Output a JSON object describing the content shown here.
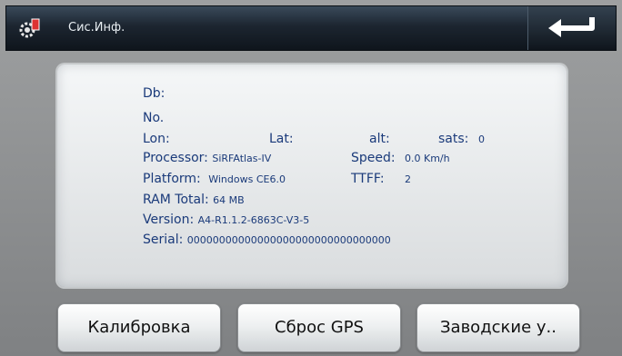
{
  "titlebar": {
    "title": "Сис.Инф.",
    "settings_icon": "settings-gear-icon",
    "back_icon": "return-arrow-icon"
  },
  "info": {
    "db_label": "Db:",
    "no_label": "No.",
    "lon_label": "Lon:",
    "lat_label": "Lat:",
    "alt_label": "alt:",
    "sats_label": "sats:",
    "sats_value": "0",
    "processor_label": "Processor:",
    "processor_value": "SiRFAtlas-IV",
    "speed_label": "Speed:",
    "speed_value": "0.0 Km/h",
    "platform_label": "Platform:",
    "platform_value": "Windows CE6.0",
    "ttff_label": "TTFF:",
    "ttff_value": "2",
    "ram_label": "RAM Total:",
    "ram_value": "64 MB",
    "version_label": "Version:",
    "version_value": "A4-R1.1.2-6863C-V3-5",
    "serial_label": "Serial:",
    "serial_value": "00000000000000000000000000000000"
  },
  "buttons": {
    "calibrate": "Калибровка",
    "reset_gps": "Сброс GPS",
    "factory": "Заводские у.."
  }
}
